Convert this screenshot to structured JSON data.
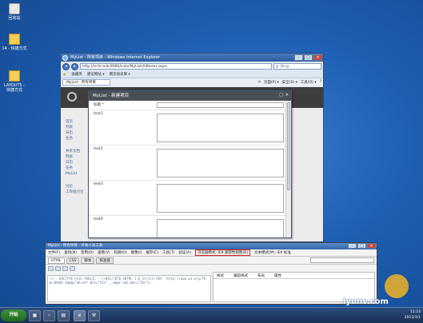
{
  "desktop": {
    "icons": [
      {
        "label": "回收站",
        "icon": "recycle-bin-icon"
      },
      {
        "label": "14 - 快捷方式",
        "icon": "folder-shortcut-icon"
      },
      {
        "label": "LAYOUTS - 快捷方式",
        "icon": "folder-shortcut-icon"
      }
    ]
  },
  "browser": {
    "title": "MyList - 所有项目 - Windows Internet Explorer",
    "address": "http://ie-fe-esb:8080/Lists/MyList/AllItems.aspx",
    "search_placeholder": "Bing",
    "favorites_label": "收藏夹",
    "favorites_links": [
      "建议网站 ▾",
      "网页快讯库 ▾"
    ],
    "tab_label": "MyList - 所有项目",
    "commands": [
      "页面(P) ▾",
      "安全(S) ▾",
      "工具(O) ▾",
      "?"
    ],
    "nav": {
      "group1": [
        "首页",
        "列表",
        "日历",
        "任务"
      ],
      "group2": [
        "共享文档",
        "列表",
        "日历",
        "任务"
      ],
      "group3": [
        "MyList"
      ],
      "group4": [
        "讨论",
        "工作组讨论"
      ]
    }
  },
  "modal": {
    "title": "MyList - 新建项目",
    "fields": [
      {
        "label": "标题",
        "required": "*",
        "type": "input"
      },
      {
        "label": "text1",
        "required": "",
        "type": "textarea"
      },
      {
        "label": "text2",
        "required": "",
        "type": "textarea"
      },
      {
        "label": "text3",
        "required": "",
        "type": "textarea"
      },
      {
        "label": "text4",
        "required": "",
        "type": "textarea"
      }
    ]
  },
  "devtools": {
    "title": "MyList - 所有项目 - 开发人员工具",
    "menu": [
      "文件(F)",
      "查找(N)",
      "禁用(D)",
      "查看(V)",
      "轮廓(O)",
      "图像(I)",
      "缓存(C)",
      "工具(T)",
      "验证(A)"
    ],
    "browser_mode": "浏览器模式: IE9 兼容性视图(B)",
    "doc_mode": "文本模式(M): IE9 标准",
    "tabs": [
      "HTML",
      "CSS",
      "脚本",
      "探查器"
    ],
    "code_lines": [
      "<!-- DOCTYPE html PUBLIC \"-//W3C//DTD XHTML 1.0 Strict//EN\" \"http://www.w3.org/TR",
      "⊞ <html lang=\"zh-cn\" dir=\"ltr\" __expr-val-dir=\"ltr\">"
    ],
    "side_tabs": [
      "样式",
      "跟踪样式",
      "布局",
      "属性"
    ]
  },
  "taskbar": {
    "start_label": "开始",
    "time": "11:14",
    "date": "2012/3/1"
  },
  "watermark": {
    "text": "iyunv.com"
  },
  "colors": {
    "desktop": "#1d5fb2",
    "sharepoint_header": "#3d3d3d",
    "modal_title": "#4a4f56",
    "highlight": "#dd2222"
  }
}
